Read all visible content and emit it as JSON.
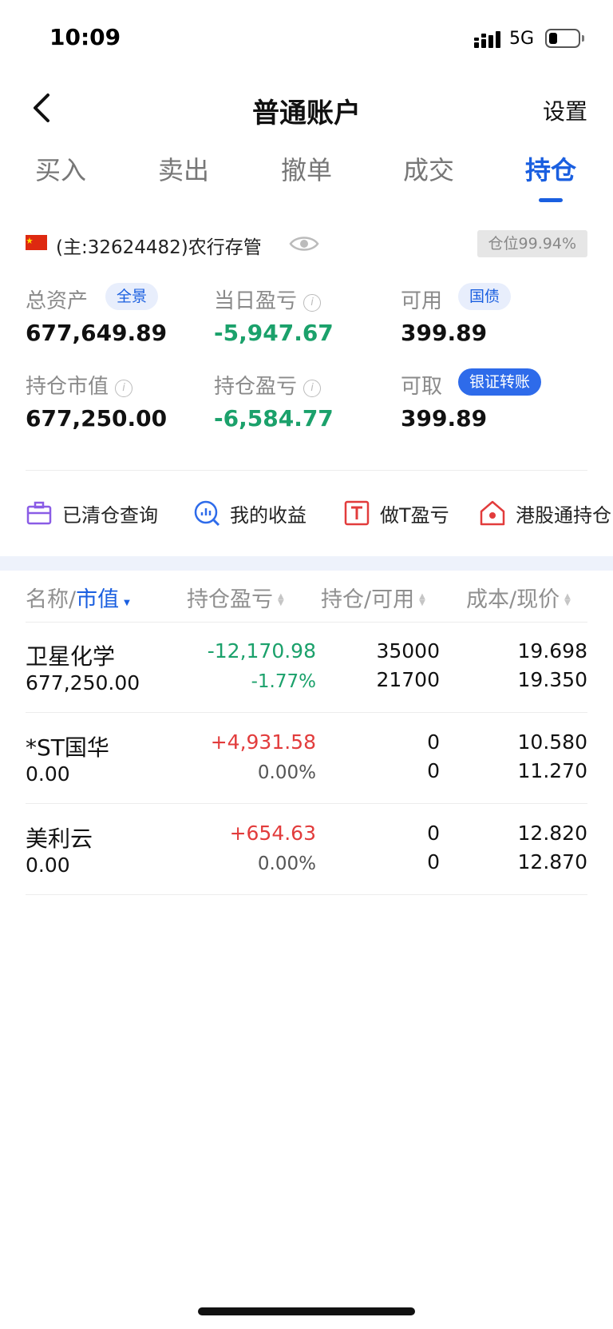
{
  "status_bar": {
    "time": "10:09",
    "network": "5G"
  },
  "nav": {
    "title": "普通账户",
    "settings_label": "设置"
  },
  "tabs": [
    {
      "label": "买入",
      "active": false
    },
    {
      "label": "卖出",
      "active": false
    },
    {
      "label": "撤单",
      "active": false
    },
    {
      "label": "成交",
      "active": false
    },
    {
      "label": "持仓",
      "active": true
    }
  ],
  "account": {
    "text": "(主:32624482)农行存管",
    "position_badge": "仓位99.94%"
  },
  "summary": {
    "total_assets_label": "总资产",
    "total_assets_chip": "全景",
    "total_assets": "677,649.89",
    "daily_pl_label": "当日盈亏",
    "daily_pl": "-5,947.67",
    "available_label": "可用",
    "available_chip": "国债",
    "available": "399.89",
    "market_value_label": "持仓市值",
    "market_value": "677,250.00",
    "holding_pl_label": "持仓盈亏",
    "holding_pl": "-6,584.77",
    "withdrawable_label": "可取",
    "withdrawable_chip": "银证转账",
    "withdrawable": "399.89"
  },
  "tools": [
    {
      "label": "已清仓查询",
      "icon": "briefcase-icon"
    },
    {
      "label": "我的收益",
      "icon": "chart-search-icon"
    },
    {
      "label": "做T盈亏",
      "icon": "t-box-icon"
    },
    {
      "label": "港股通持仓",
      "icon": "hk-house-icon"
    }
  ],
  "table_header": {
    "name_prefix": "名称/",
    "name_sort": "市值",
    "pl": "持仓盈亏",
    "hold": "持仓/可用",
    "cost": "成本/现价"
  },
  "rows": [
    {
      "name": "卫星化学",
      "market_value": "677,250.00",
      "pl": "-12,170.98",
      "pl_pct": "-1.77%",
      "hold": "35000",
      "avail": "21700",
      "cost": "19.698",
      "price": "19.350",
      "pl_color": "green",
      "pct_color": "green"
    },
    {
      "name": "*ST国华",
      "market_value": "0.00",
      "pl": "+4,931.58",
      "pl_pct": "0.00%",
      "hold": "0",
      "avail": "0",
      "cost": "10.580",
      "price": "11.270",
      "pl_color": "red",
      "pct_color": "gray"
    },
    {
      "name": "美利云",
      "market_value": "0.00",
      "pl": "+654.63",
      "pl_pct": "0.00%",
      "hold": "0",
      "avail": "0",
      "cost": "12.820",
      "price": "12.870",
      "pl_color": "red",
      "pct_color": "gray"
    }
  ],
  "colors": {
    "accent": "#1a5fe0",
    "gain": "#e23c3c",
    "loss": "#1ba16b"
  }
}
